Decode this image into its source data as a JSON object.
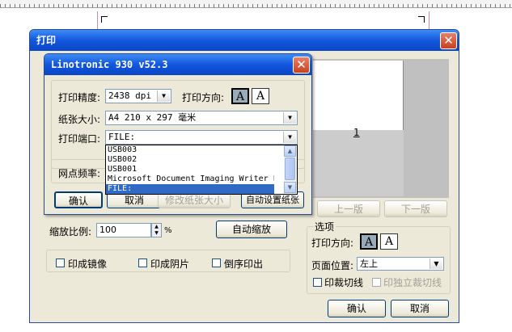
{
  "print_dialog": {
    "title": "打印",
    "zoom": {
      "label": "缩放比例:",
      "value": "100",
      "unit": "%",
      "auto_button": "自动缩放"
    },
    "checkboxes": [
      "印成镜像",
      "印成阴片",
      "倒序印出"
    ],
    "preview": {
      "page_number": "1",
      "prev_button": "上一版",
      "next_button": "下一版"
    },
    "options": {
      "group_label": "选项",
      "orientation_label": "打印方向:",
      "position_label": "页面位置:",
      "position_value": "左上",
      "print_cut_lines": "印裁切线",
      "print_separate_cut_lines": "印独立裁切线"
    },
    "ok_button": "确认",
    "cancel_button": "取消"
  },
  "printer_dialog": {
    "title": "Linotronic 930 v52.3",
    "resolution_label": "打印精度:",
    "resolution_value": "2438 dpi",
    "orientation_label": "打印方向:",
    "paper_size_label": "纸张大小:",
    "paper_size_value": "A4 210 x 297 毫米",
    "port_label": "打印端口:",
    "port_value": "FILE:",
    "port_options": [
      "USB003",
      "USB002",
      "USB001",
      "Microsoft Document Imaging Writer Por",
      "FILE:"
    ],
    "screen_freq_label": "网点频率:",
    "ok_button": "确认",
    "cancel_button": "取消",
    "change_size_button": "修改纸张大小",
    "auto_size_button": "自动设置纸张"
  },
  "icons": {
    "close": "close-icon",
    "dropdown": "chevron-down-icon",
    "portrait": "portrait-orientation-icon",
    "landscape": "landscape-orientation-icon"
  }
}
